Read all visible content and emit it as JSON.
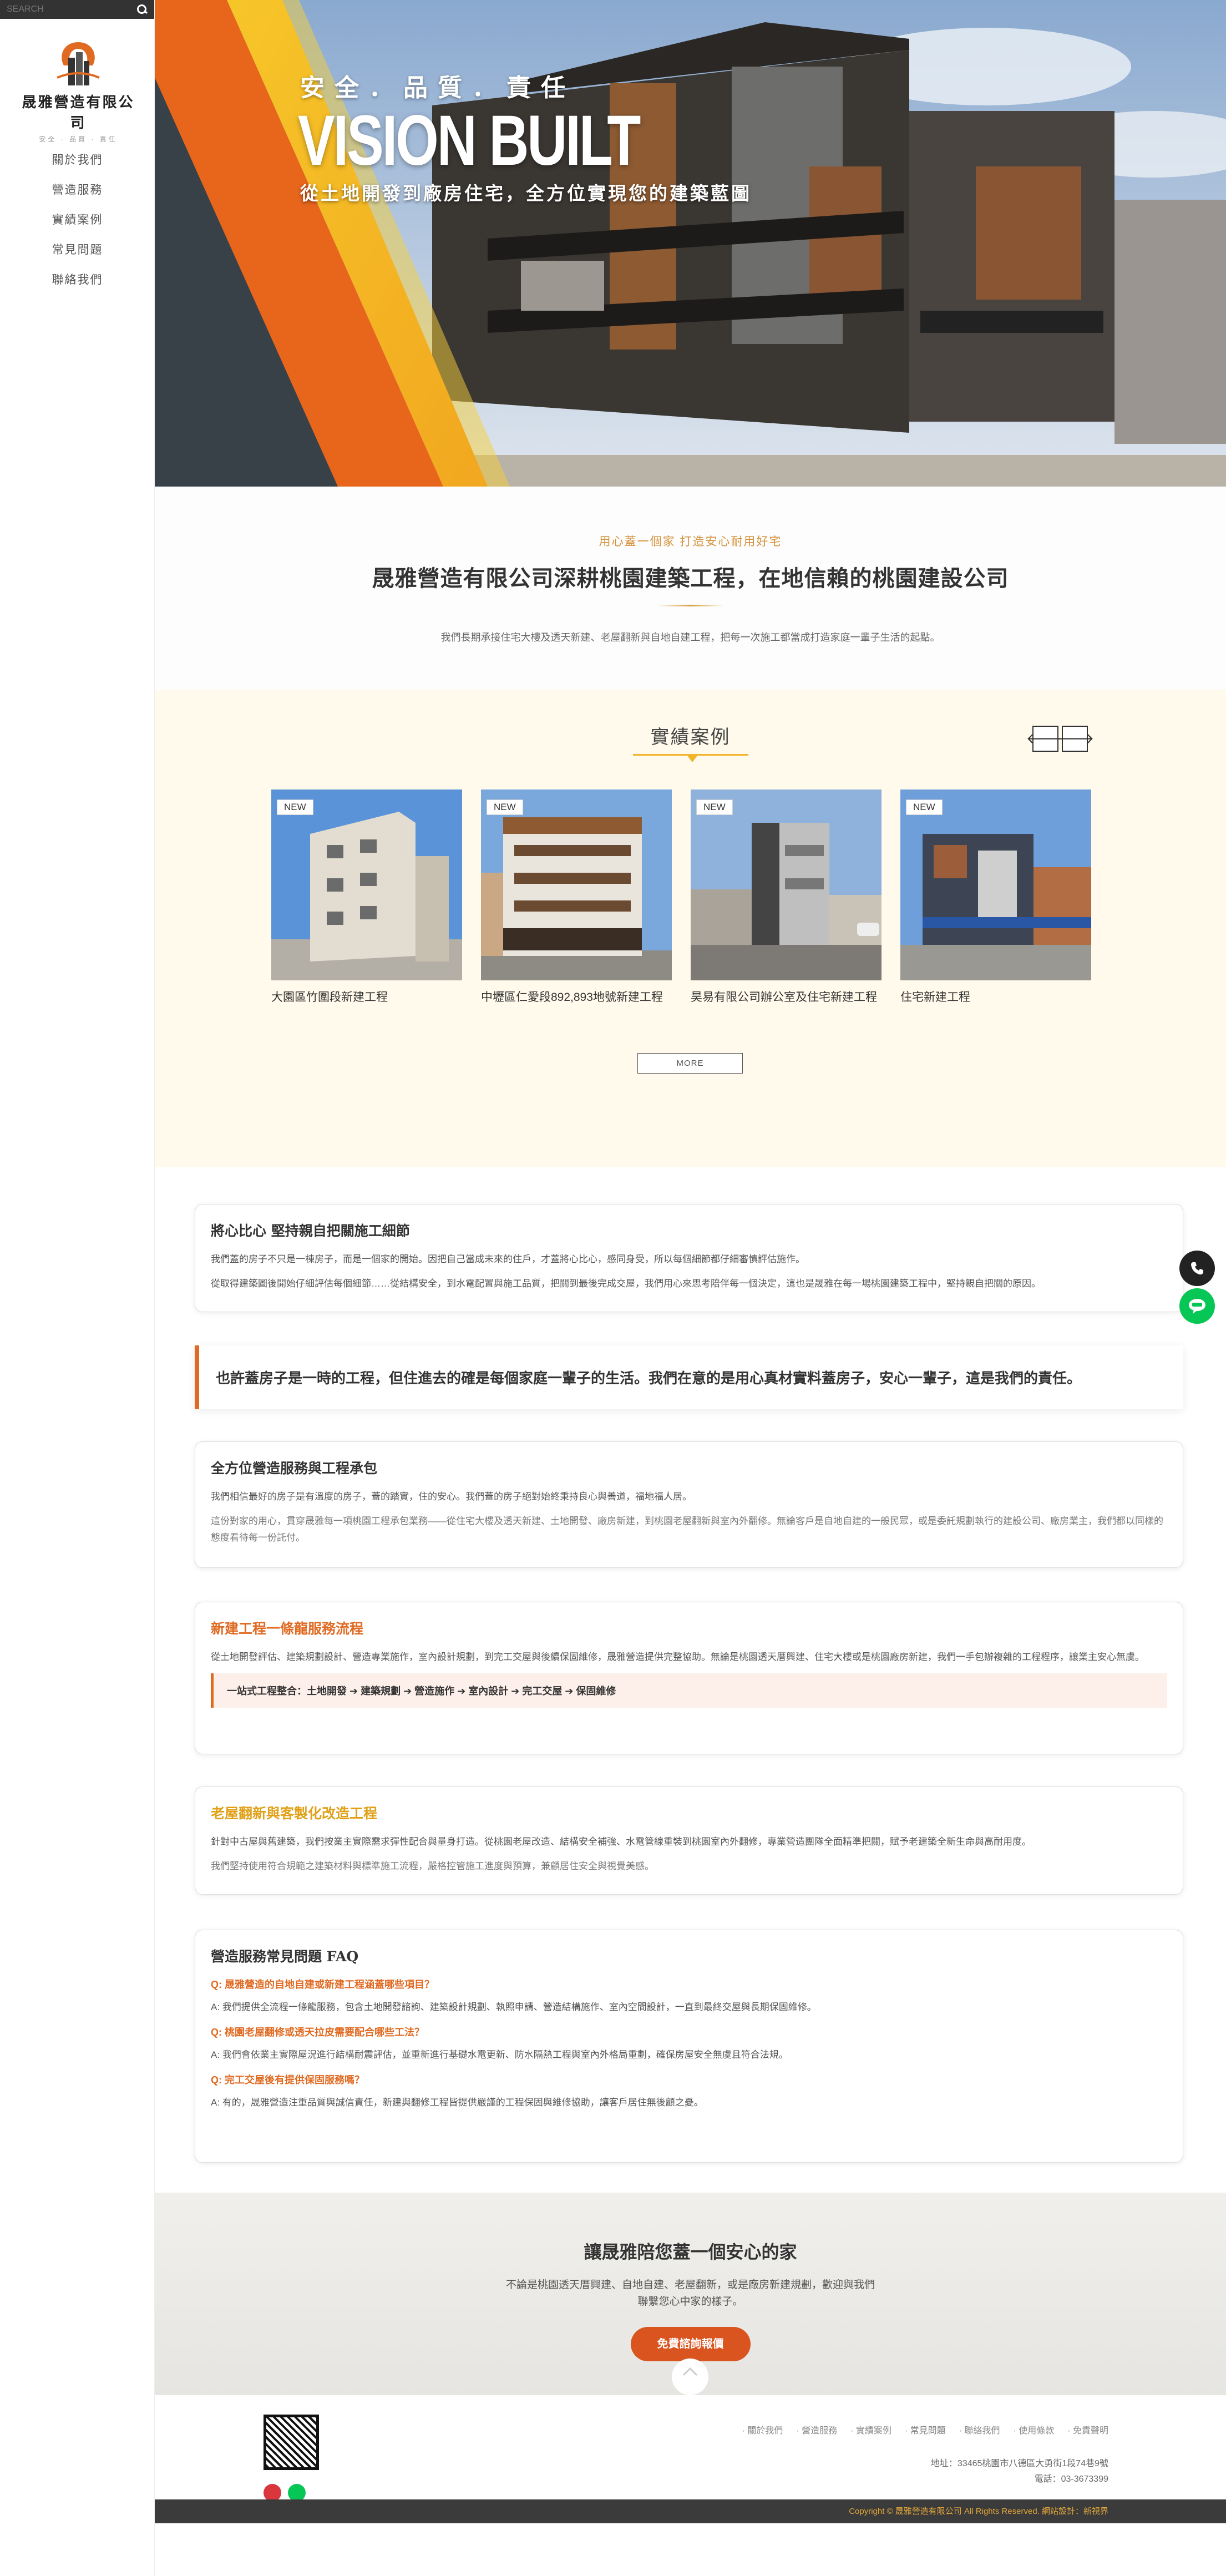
{
  "search": {
    "placeholder": "SEARCH"
  },
  "brand": {
    "name": "晟雅營造有限公司",
    "slogan": "安全 · 品質 · 責任"
  },
  "nav": [
    "關於我們",
    "營造服務",
    "實績案例",
    "常見問題",
    "聯絡我們"
  ],
  "hero": {
    "tagline": "安全．品質．責任",
    "headline": "VISION BUILT",
    "subline": "從土地開發到廠房住宅，全方位實現您的建築藍圖"
  },
  "intro": {
    "subtitle": "用心蓋一個家 打造安心耐用好宅",
    "title": "晟雅營造有限公司深耕桃園建築工程，在地信賴的桃園建設公司",
    "text": "我們長期承接住宅大樓及透天新建、老屋翻新與自地自建工程，把每一次施工都當成打造家庭一輩子生活的起點。"
  },
  "cases": {
    "title": "實績案例",
    "prev": "🡐",
    "next": "🡒",
    "badge": "NEW",
    "items": [
      {
        "caption": "大園區竹圍段新建工程"
      },
      {
        "caption": "中壢區仁愛段892,893地號新建工程"
      },
      {
        "caption": "昊易有限公司辦公室及住宅新建工程"
      },
      {
        "caption": "住宅新建工程"
      }
    ],
    "more": "MORE"
  },
  "sections": {
    "s1": {
      "title": "將心比心 堅持親自把關施工細節",
      "p1": "我們蓋的房子不只是一棟房子，而是一個家的開始。因把自己當成未來的住戶，才蓋將心比心，感同身受，所以每個細節都仔細審慎評估施作。",
      "p2": "從取得建築圖後開始仔細評估每個細節……從結構安全，到水電配置與施工品質，把關到最後完成交屋，我們用心來思考陪伴每一個決定，這也是晟雅在每一場桃園建築工程中，堅持親自把關的原因。"
    },
    "quote": "也許蓋房子是一時的工程，但住進去的確是每個家庭一輩子的生活。我們在意的是用心真材實料蓋房子，安心一輩子，這是我們的責任。",
    "s2": {
      "title": "全方位營造服務與工程承包",
      "p1": "我們相信最好的房子是有溫度的房子，蓋的踏實，住的安心。我們蓋的房子絕對始終秉持良心與善道，福地福人居。",
      "p2": "這份對家的用心，貫穿晟雅每一項桃園工程承包業務——從住宅大樓及透天新建、土地開發、廠房新建，到桃園老屋翻新與室內外翻修。無論客戶是自地自建的一般民眾，或是委託規劃執行的建設公司、廠房業主，我們都以同樣的態度看待每一份託付。"
    },
    "s3": {
      "title": "新建工程一條龍服務流程",
      "p1": "從土地開發評估、建築規劃設計、營造專業施作，室內設計規劃，到完工交屋與後續保固維修，晟雅營造提供完整協助。無論是桃園透天厝興建、住宅大樓或是桃園廠房新建，我們一手包辦複雜的工程程序，讓業主安心無虞。",
      "flow": "一站式工程整合：土地開發 ➔ 建築規劃 ➔ 營造施作 ➔ 室內設計 ➔ 完工交屋 ➔ 保固維修"
    },
    "s4": {
      "title": "老屋翻新與客製化改造工程",
      "p1": "針對中古屋與舊建築，我們按業主實際需求彈性配合與量身打造。從桃園老屋改造、結構安全補強、水電管線重裝到桃園室內外翻修，專業營造團隊全面精準把關，賦予老建築全新生命與高耐用度。",
      "p2": "我們堅持使用符合規範之建築材料與標準施工流程，嚴格控管施工進度與預算，兼顧居住安全與視覺美感。"
    },
    "faq": {
      "title": "營造服務常見問題 FAQ",
      "items": [
        {
          "q": "Q: 晟雅營造的自地自建或新建工程涵蓋哪些項目？",
          "a": "A: 我們提供全流程一條龍服務，包含土地開發諮詢、建築設計規劃、執照申請、營造結構施作、室內空間設計，一直到最終交屋與長期保固維修。"
        },
        {
          "q": "Q: 桃園老屋翻修或透天拉皮需要配合哪些工法？",
          "a": "A: 我們會依業主實際屋況進行結構耐震評估，並重新進行基礎水電更新、防水隔熱工程與室內外格局重劃，確保房屋安全無虞且符合法規。"
        },
        {
          "q": "Q: 完工交屋後有提供保固服務嗎？",
          "a": "A: 有的，晟雅營造注重品質與誠信責任，新建與翻修工程皆提供嚴謹的工程保固與維修協助，讓客戶居住無後顧之憂。"
        }
      ]
    }
  },
  "cta": {
    "title": "讓晟雅陪您蓋一個安心的家",
    "text1": "不論是桃園透天厝興建、自地自建、老屋翻新，或是廠房新建規劃，歡迎與我們",
    "text2": "聯繫您心中家的樣子。",
    "button": "免費諮詢報價"
  },
  "footer": {
    "links": [
      "· 關於我們",
      "· 營造服務",
      "· 實績案例",
      "· 常見問題",
      "· 聯絡我們",
      "· 使用條款",
      "· 免責聲明"
    ],
    "address": "地址：33465桃園市八德區大勇街1段74巷9號",
    "phone": "電話：03-3673399",
    "copyright": "Copyright © 晟雅營造有限公司 All Rights Reserved. 網站設計：新視界"
  },
  "colors": {
    "accent": "#e06a22",
    "gold": "#f0b52c",
    "phone": "#222222",
    "line": "#06c755"
  }
}
